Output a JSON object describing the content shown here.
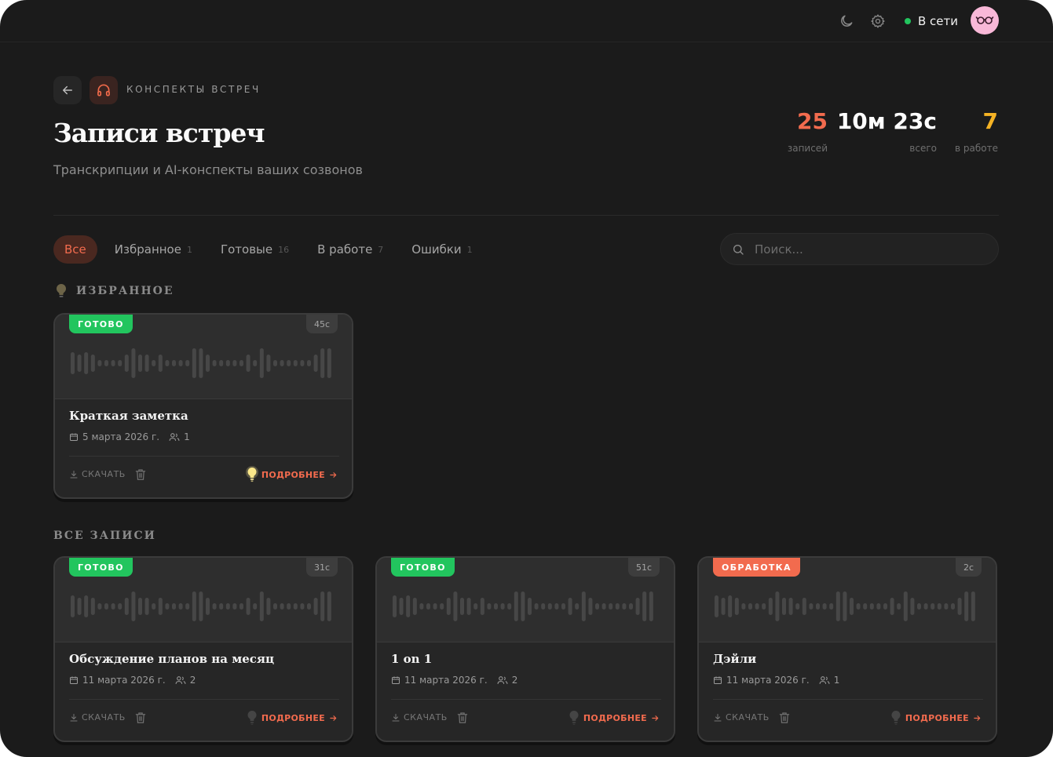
{
  "header": {
    "status_label": "В сети",
    "icons": [
      "moon-icon",
      "settings-icon",
      "avatar-glasses-icon"
    ]
  },
  "breadcrumb": {
    "label": "КОНСПЕКТЫ ВСТРЕЧ",
    "icon": "headphones-icon"
  },
  "page": {
    "title": "Записи встреч",
    "subtitle": "Транскрипции и AI-конспекты ваших созвонов"
  },
  "stats": [
    {
      "value": "25",
      "label": "записей",
      "color": "#f26b4e"
    },
    {
      "value": "10м 23с",
      "label": "всего",
      "color": "#ffffff"
    },
    {
      "value": "7",
      "label": "в работе",
      "color": "#f5b324"
    }
  ],
  "tabs": [
    {
      "label": "Все",
      "count": "",
      "active": true
    },
    {
      "label": "Избранное",
      "count": "1"
    },
    {
      "label": "Готовые",
      "count": "16"
    },
    {
      "label": "В работе",
      "count": "7"
    },
    {
      "label": "Ошибки",
      "count": "1"
    }
  ],
  "search": {
    "placeholder": "Поиск..."
  },
  "sections": {
    "favorites": "ИЗБРАННОЕ",
    "all": "ВСЕ ЗАПИСИ"
  },
  "card_actions": {
    "download": "СКАЧАТЬ",
    "details": "ПОДРОБНЕЕ"
  },
  "status_colors": {
    "ready": "#22c55e",
    "processing": "#f26b4e"
  },
  "favorites": [
    {
      "status": "ГОТОВО",
      "status_kind": "ready",
      "duration": "45с",
      "title": "Краткая заметка",
      "date": "5 марта 2026 г.",
      "participants": "1",
      "favorite": true
    }
  ],
  "recordings": [
    {
      "status": "ГОТОВО",
      "status_kind": "ready",
      "duration": "31с",
      "title": "Обсуждение планов на месяц",
      "date": "11 марта 2026 г.",
      "participants": "2",
      "favorite": false
    },
    {
      "status": "ГОТОВО",
      "status_kind": "ready",
      "duration": "51с",
      "title": "1 on 1",
      "date": "11 марта 2026 г.",
      "participants": "2",
      "favorite": false
    },
    {
      "status": "ОБРАБОТКА",
      "status_kind": "processing",
      "duration": "2с",
      "title": "Дэйли",
      "date": "11 марта 2026 г.",
      "participants": "1",
      "favorite": false
    }
  ]
}
